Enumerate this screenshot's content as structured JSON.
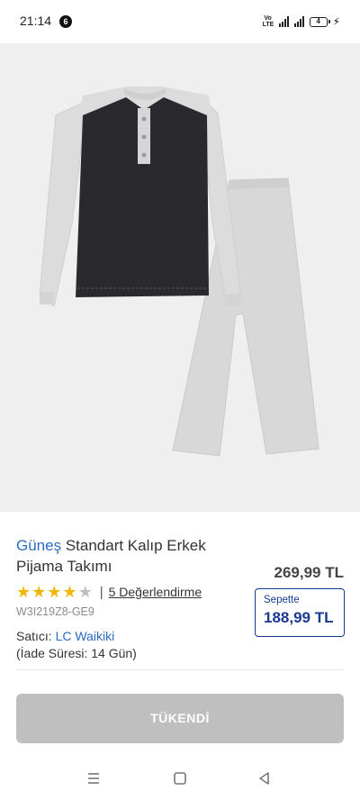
{
  "status_bar": {
    "time": "21:14",
    "notification_count": "6",
    "network_label": "Vo LTE",
    "battery_level": "4"
  },
  "product": {
    "brand": "Güneş",
    "title_rest": " Standart Kalıp Erkek Pijama Takımı",
    "price": "269,99 TL",
    "rating": 4,
    "rating_max": 5,
    "reviews_label": "5 Değerlendirme",
    "sku": "W3I219Z8-GE9",
    "basket": {
      "label": "Sepette",
      "price": "188,99 TL"
    },
    "seller_label": "Satıcı:",
    "seller_name": "LC Waikiki",
    "return_period": "(İade Süresi: 14 Gün)"
  },
  "actions": {
    "sold_out_label": "TÜKENDİ"
  },
  "colors": {
    "brand_blue": "#2c6bbf",
    "basket_navy": "#1a3a8f",
    "star": "#f2b705",
    "disabled_button": "#bfbfbf"
  },
  "icons": {
    "nav_menu": "menu-icon",
    "nav_home": "square-home-icon",
    "nav_back": "triangle-back-icon"
  }
}
